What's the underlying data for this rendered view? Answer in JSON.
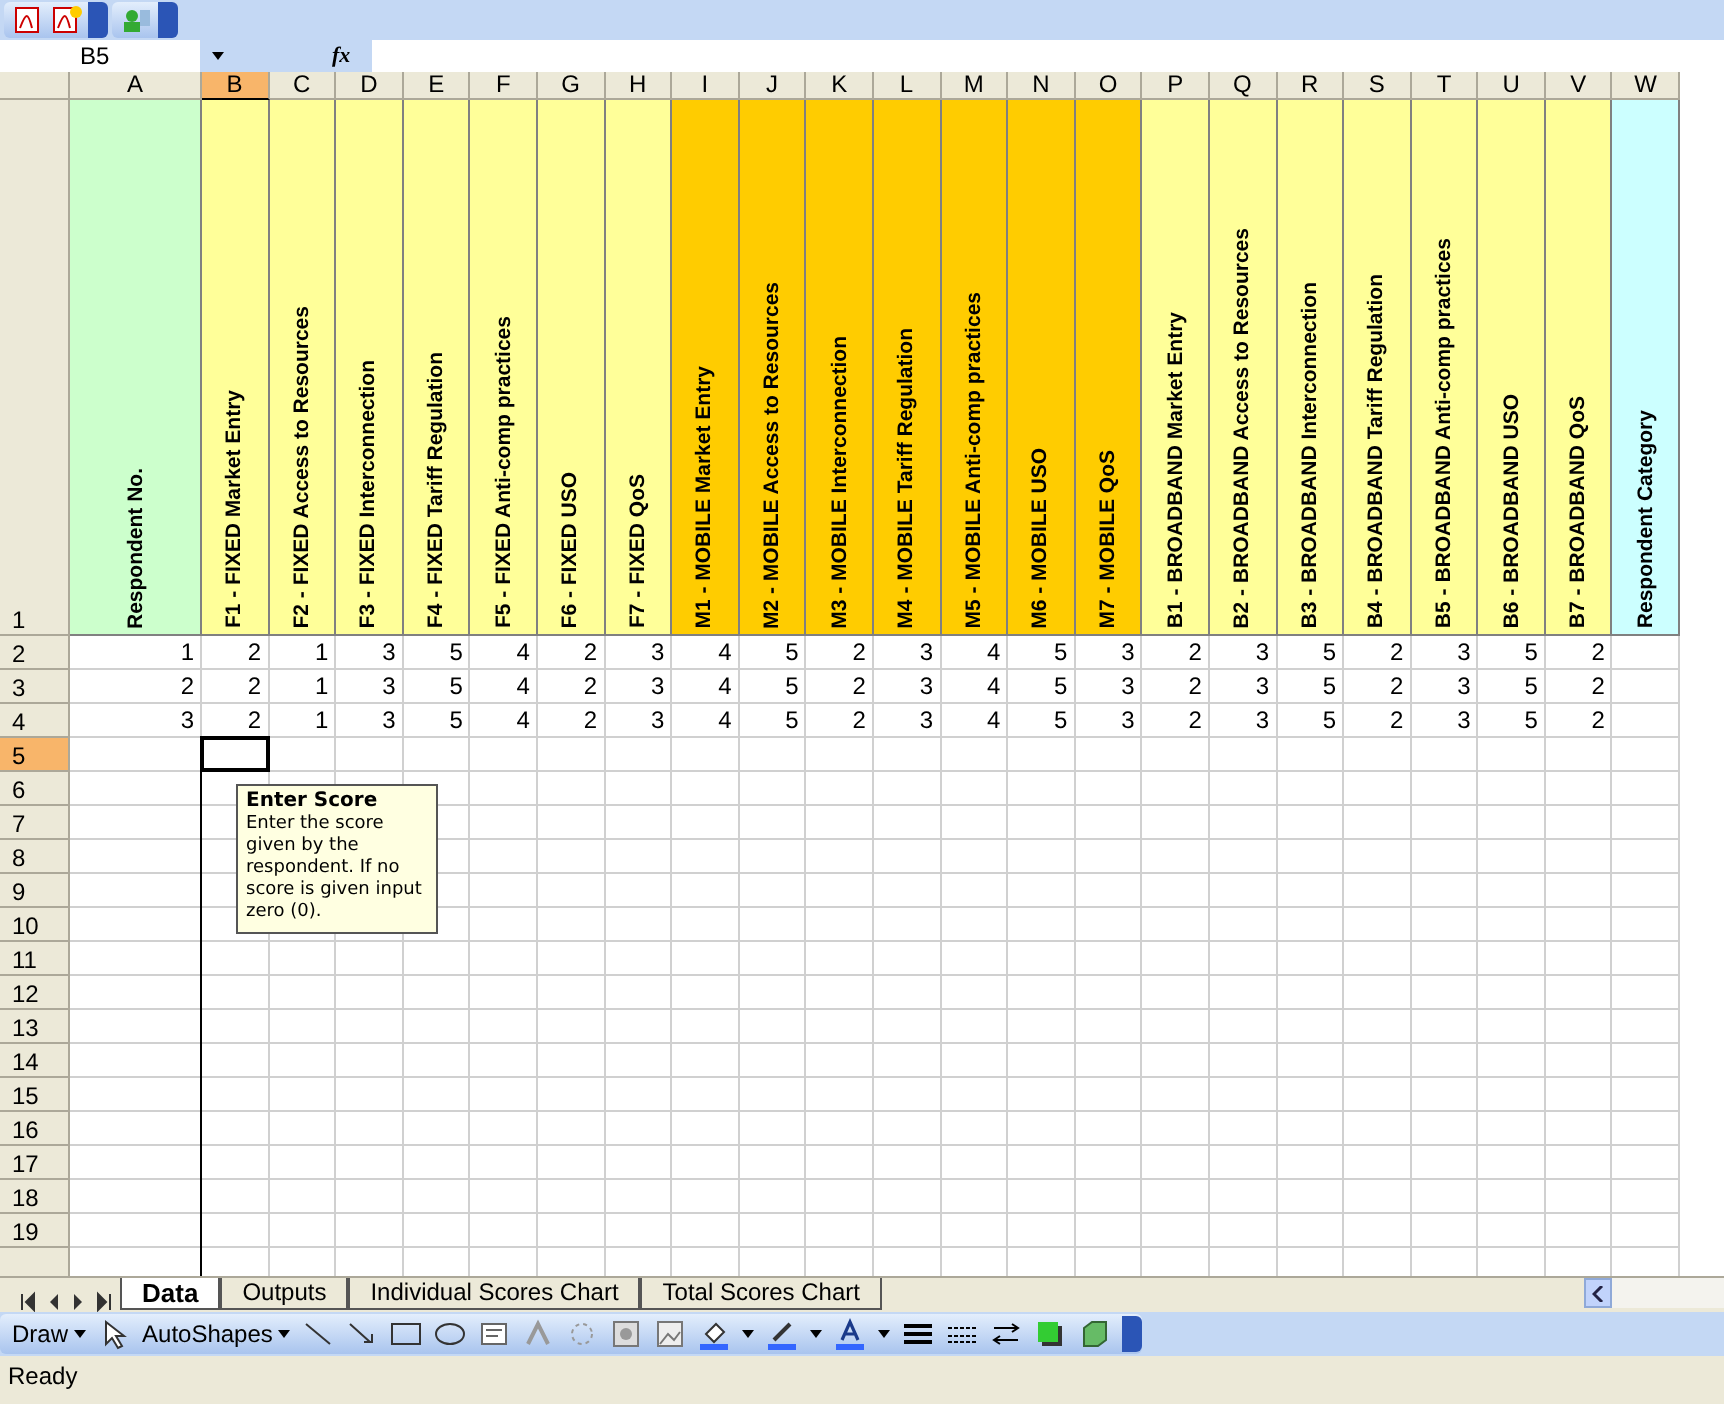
{
  "formula_bar": {
    "name_box": "B5",
    "fx": "fx"
  },
  "columns": [
    {
      "letter": "A",
      "header": "Respondent No.",
      "color": "#ccffcc",
      "selected": false
    },
    {
      "letter": "B",
      "header": "F1 - FIXED Market Entry",
      "color": "#ffff99",
      "selected": true
    },
    {
      "letter": "C",
      "header": "F2 - FIXED Access to Resources",
      "color": "#ffff99",
      "selected": false
    },
    {
      "letter": "D",
      "header": "F3 - FIXED Interconnection",
      "color": "#ffff99",
      "selected": false
    },
    {
      "letter": "E",
      "header": "F4 - FIXED Tariff Regulation",
      "color": "#ffff99",
      "selected": false
    },
    {
      "letter": "F",
      "header": "F5 - FIXED Anti-comp practices",
      "color": "#ffff99",
      "selected": false
    },
    {
      "letter": "G",
      "header": "F6 - FIXED USO",
      "color": "#ffff99",
      "selected": false
    },
    {
      "letter": "H",
      "header": "F7 - FIXED QoS",
      "color": "#ffff99",
      "selected": false
    },
    {
      "letter": "I",
      "header": "M1 - MOBILE Market Entry",
      "color": "#ffcc00",
      "selected": false
    },
    {
      "letter": "J",
      "header": "M2 - MOBILE Access to Resources",
      "color": "#ffcc00",
      "selected": false
    },
    {
      "letter": "K",
      "header": "M3 - MOBILE Interconnection",
      "color": "#ffcc00",
      "selected": false
    },
    {
      "letter": "L",
      "header": "M4 - MOBILE Tariff Regulation",
      "color": "#ffcc00",
      "selected": false
    },
    {
      "letter": "M",
      "header": "M5 - MOBILE Anti-comp practices",
      "color": "#ffcc00",
      "selected": false
    },
    {
      "letter": "N",
      "header": "M6 - MOBILE USO",
      "color": "#ffcc00",
      "selected": false
    },
    {
      "letter": "O",
      "header": "M7 - MOBILE QoS",
      "color": "#ffcc00",
      "selected": false
    },
    {
      "letter": "P",
      "header": "B1 - BROADBAND Market Entry",
      "color": "#ffff99",
      "selected": false
    },
    {
      "letter": "Q",
      "header": "B2 - BROADBAND Access to Resources",
      "color": "#ffff99",
      "selected": false
    },
    {
      "letter": "R",
      "header": "B3 - BROADBAND Interconnection",
      "color": "#ffff99",
      "selected": false
    },
    {
      "letter": "S",
      "header": "B4 - BROADBAND Tariff Regulation",
      "color": "#ffff99",
      "selected": false
    },
    {
      "letter": "T",
      "header": "B5 - BROADBAND Anti-comp practices",
      "color": "#ffff99",
      "selected": false
    },
    {
      "letter": "U",
      "header": "B6 - BROADBAND USO",
      "color": "#ffff99",
      "selected": false
    },
    {
      "letter": "V",
      "header": "B7 - BROADBAND QoS",
      "color": "#ffff99",
      "selected": false
    },
    {
      "letter": "W",
      "header": "Respondent Category",
      "color": "#ccffff",
      "selected": false
    }
  ],
  "header_row": "1",
  "rows": [
    {
      "label": "2",
      "selected": false,
      "cells": [
        "1",
        "2",
        "1",
        "3",
        "5",
        "4",
        "2",
        "3",
        "4",
        "5",
        "2",
        "3",
        "4",
        "5",
        "3",
        "2",
        "3",
        "5",
        "2",
        "3",
        "5",
        "2"
      ]
    },
    {
      "label": "3",
      "selected": false,
      "cells": [
        "2",
        "2",
        "1",
        "3",
        "5",
        "4",
        "2",
        "3",
        "4",
        "5",
        "2",
        "3",
        "4",
        "5",
        "3",
        "2",
        "3",
        "5",
        "2",
        "3",
        "5",
        "2"
      ]
    },
    {
      "label": "4",
      "selected": false,
      "cells": [
        "3",
        "2",
        "1",
        "3",
        "5",
        "4",
        "2",
        "3",
        "4",
        "5",
        "2",
        "3",
        "4",
        "5",
        "3",
        "2",
        "3",
        "5",
        "2",
        "3",
        "5",
        "2"
      ]
    },
    {
      "label": "5",
      "selected": true,
      "cells": []
    },
    {
      "label": "6",
      "selected": false,
      "cells": []
    },
    {
      "label": "7",
      "selected": false,
      "cells": []
    },
    {
      "label": "8",
      "selected": false,
      "cells": []
    },
    {
      "label": "9",
      "selected": false,
      "cells": []
    },
    {
      "label": "10",
      "selected": false,
      "cells": []
    },
    {
      "label": "11",
      "selected": false,
      "cells": []
    },
    {
      "label": "12",
      "selected": false,
      "cells": []
    },
    {
      "label": "13",
      "selected": false,
      "cells": []
    },
    {
      "label": "14",
      "selected": false,
      "cells": []
    },
    {
      "label": "15",
      "selected": false,
      "cells": []
    },
    {
      "label": "16",
      "selected": false,
      "cells": []
    },
    {
      "label": "17",
      "selected": false,
      "cells": []
    },
    {
      "label": "18",
      "selected": false,
      "cells": []
    },
    {
      "label": "19",
      "selected": false,
      "cells": []
    }
  ],
  "tooltip": {
    "title": "Enter Score",
    "text": "Enter the score given by the respondent. If no score is given input zero (0)."
  },
  "sheet_tabs": [
    {
      "label": "Data",
      "selected": true
    },
    {
      "label": "Outputs",
      "selected": false
    },
    {
      "label": "Individual Scores Chart",
      "selected": false
    },
    {
      "label": "Total Scores Chart",
      "selected": false
    }
  ],
  "draw_toolbar": {
    "draw": "Draw",
    "autoshapes": "AutoShapes"
  },
  "status_bar": "Ready"
}
